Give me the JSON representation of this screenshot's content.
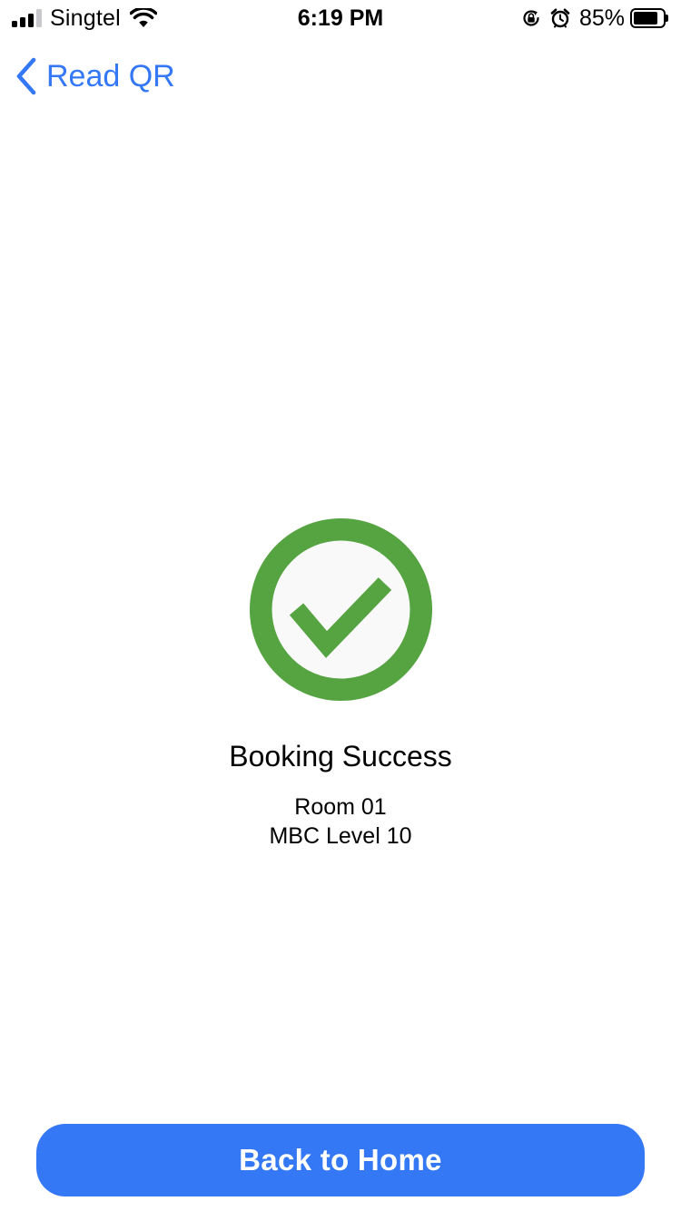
{
  "status_bar": {
    "carrier": "Singtel",
    "time": "6:19 PM",
    "battery_percent_label": "85%",
    "battery_level": 0.85,
    "signal_bars_filled": 3,
    "signal_bars_total": 4,
    "icons": [
      "signal-icon",
      "wifi-icon",
      "lock-rotation-icon",
      "alarm-icon",
      "battery-icon"
    ]
  },
  "nav": {
    "back_label": "Read QR",
    "back_icon": "chevron-left-icon"
  },
  "content": {
    "icon": "checkmark-circle-icon",
    "title": "Booking Success",
    "room": "Room 01",
    "location": "MBC Level 10"
  },
  "actions": {
    "home_label": "Back to Home"
  },
  "colors": {
    "accent": "#3478f6",
    "success": "#55a441",
    "success_inner": "#f9f9f9",
    "text": "#000000",
    "background": "#ffffff"
  }
}
